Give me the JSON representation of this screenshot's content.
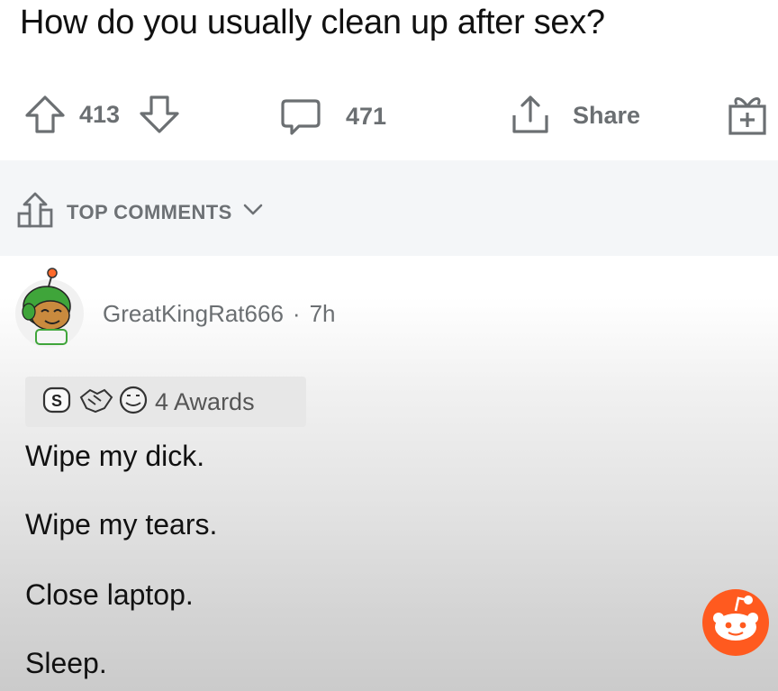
{
  "post": {
    "title": "How do you usually clean up after sex?"
  },
  "actions": {
    "upvotes": "413",
    "comments": "471",
    "share_label": "Share"
  },
  "sort": {
    "label": "TOP COMMENTS"
  },
  "comment": {
    "author": "GreatKingRat666",
    "separator": "·",
    "age": "7h",
    "awards_label": "4 Awards",
    "lines": [
      "Wipe my dick.",
      "Wipe my tears.",
      "Close laptop.",
      "Sleep."
    ]
  },
  "colors": {
    "reddit_orange": "#ff5a1f",
    "meta_gray": "#6b6f72",
    "sort_bar": "#f4f6f8"
  },
  "icons": [
    "upvote-icon",
    "downvote-icon",
    "comment-icon",
    "share-icon",
    "gift-icon",
    "sort-icon",
    "chevron-down-icon",
    "silver-award-icon",
    "handshake-award-icon",
    "smile-award-icon",
    "snoo-icon"
  ]
}
